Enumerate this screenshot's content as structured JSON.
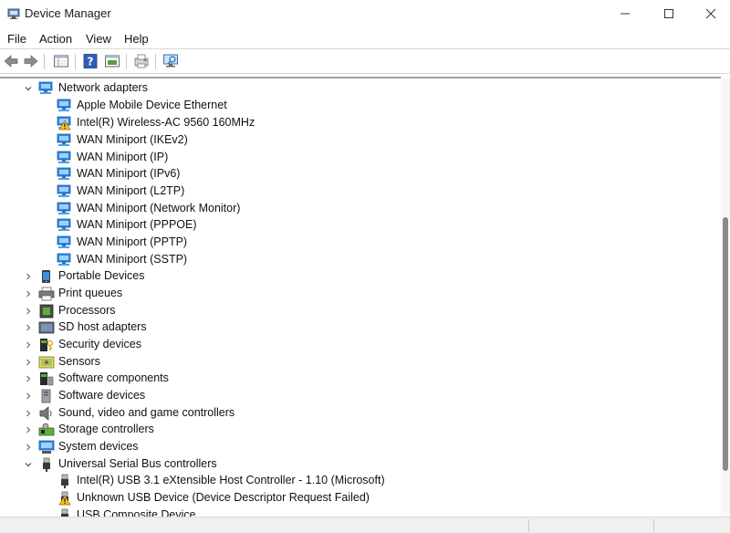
{
  "window": {
    "title": "Device Manager",
    "controls": {
      "minimize": "—",
      "maximize": "☐",
      "close": "✕"
    }
  },
  "menu": {
    "items": [
      "File",
      "Action",
      "View",
      "Help"
    ]
  },
  "toolbar": {
    "buttons": [
      "back-icon",
      "forward-icon",
      "properties-grid-icon",
      "help-icon",
      "show-hidden-icon",
      "update-driver-icon",
      "scan-hardware-icon"
    ]
  },
  "tree": {
    "network_adapters": {
      "label": "Network adapters",
      "expanded": true,
      "children": [
        {
          "label": "Apple Mobile Device Ethernet",
          "warning": false
        },
        {
          "label": "Intel(R) Wireless-AC 9560 160MHz",
          "warning": true
        },
        {
          "label": "WAN Miniport (IKEv2)",
          "warning": false
        },
        {
          "label": "WAN Miniport (IP)",
          "warning": false
        },
        {
          "label": "WAN Miniport (IPv6)",
          "warning": false
        },
        {
          "label": "WAN Miniport (L2TP)",
          "warning": false
        },
        {
          "label": "WAN Miniport (Network Monitor)",
          "warning": false
        },
        {
          "label": "WAN Miniport (PPPOE)",
          "warning": false
        },
        {
          "label": "WAN Miniport (PPTP)",
          "warning": false
        },
        {
          "label": "WAN Miniport (SSTP)",
          "warning": false
        }
      ]
    },
    "categories": [
      {
        "label": "Portable Devices",
        "icon": "portable-device-icon"
      },
      {
        "label": "Print queues",
        "icon": "printer-icon"
      },
      {
        "label": "Processors",
        "icon": "processor-icon"
      },
      {
        "label": "SD host adapters",
        "icon": "sd-adapter-icon"
      },
      {
        "label": "Security devices",
        "icon": "security-device-icon"
      },
      {
        "label": "Sensors",
        "icon": "sensor-icon"
      },
      {
        "label": "Software components",
        "icon": "software-component-icon"
      },
      {
        "label": "Software devices",
        "icon": "software-device-icon"
      },
      {
        "label": "Sound, video and game controllers",
        "icon": "speaker-icon"
      },
      {
        "label": "Storage controllers",
        "icon": "storage-controller-icon"
      },
      {
        "label": "System devices",
        "icon": "system-device-icon"
      }
    ],
    "usb": {
      "label": "Universal Serial Bus controllers",
      "expanded": true,
      "children": [
        {
          "label": "Intel(R) USB 3.1 eXtensible Host Controller - 1.10 (Microsoft)",
          "warning": false
        },
        {
          "label": "Unknown USB Device (Device Descriptor Request Failed)",
          "warning": true
        },
        {
          "label": "USB Composite Device",
          "warning": false
        }
      ]
    }
  },
  "colors": {
    "monitor_blue": "#1e88e5",
    "warning_yellow": "#f5c518",
    "selection": "#cce8ff"
  }
}
